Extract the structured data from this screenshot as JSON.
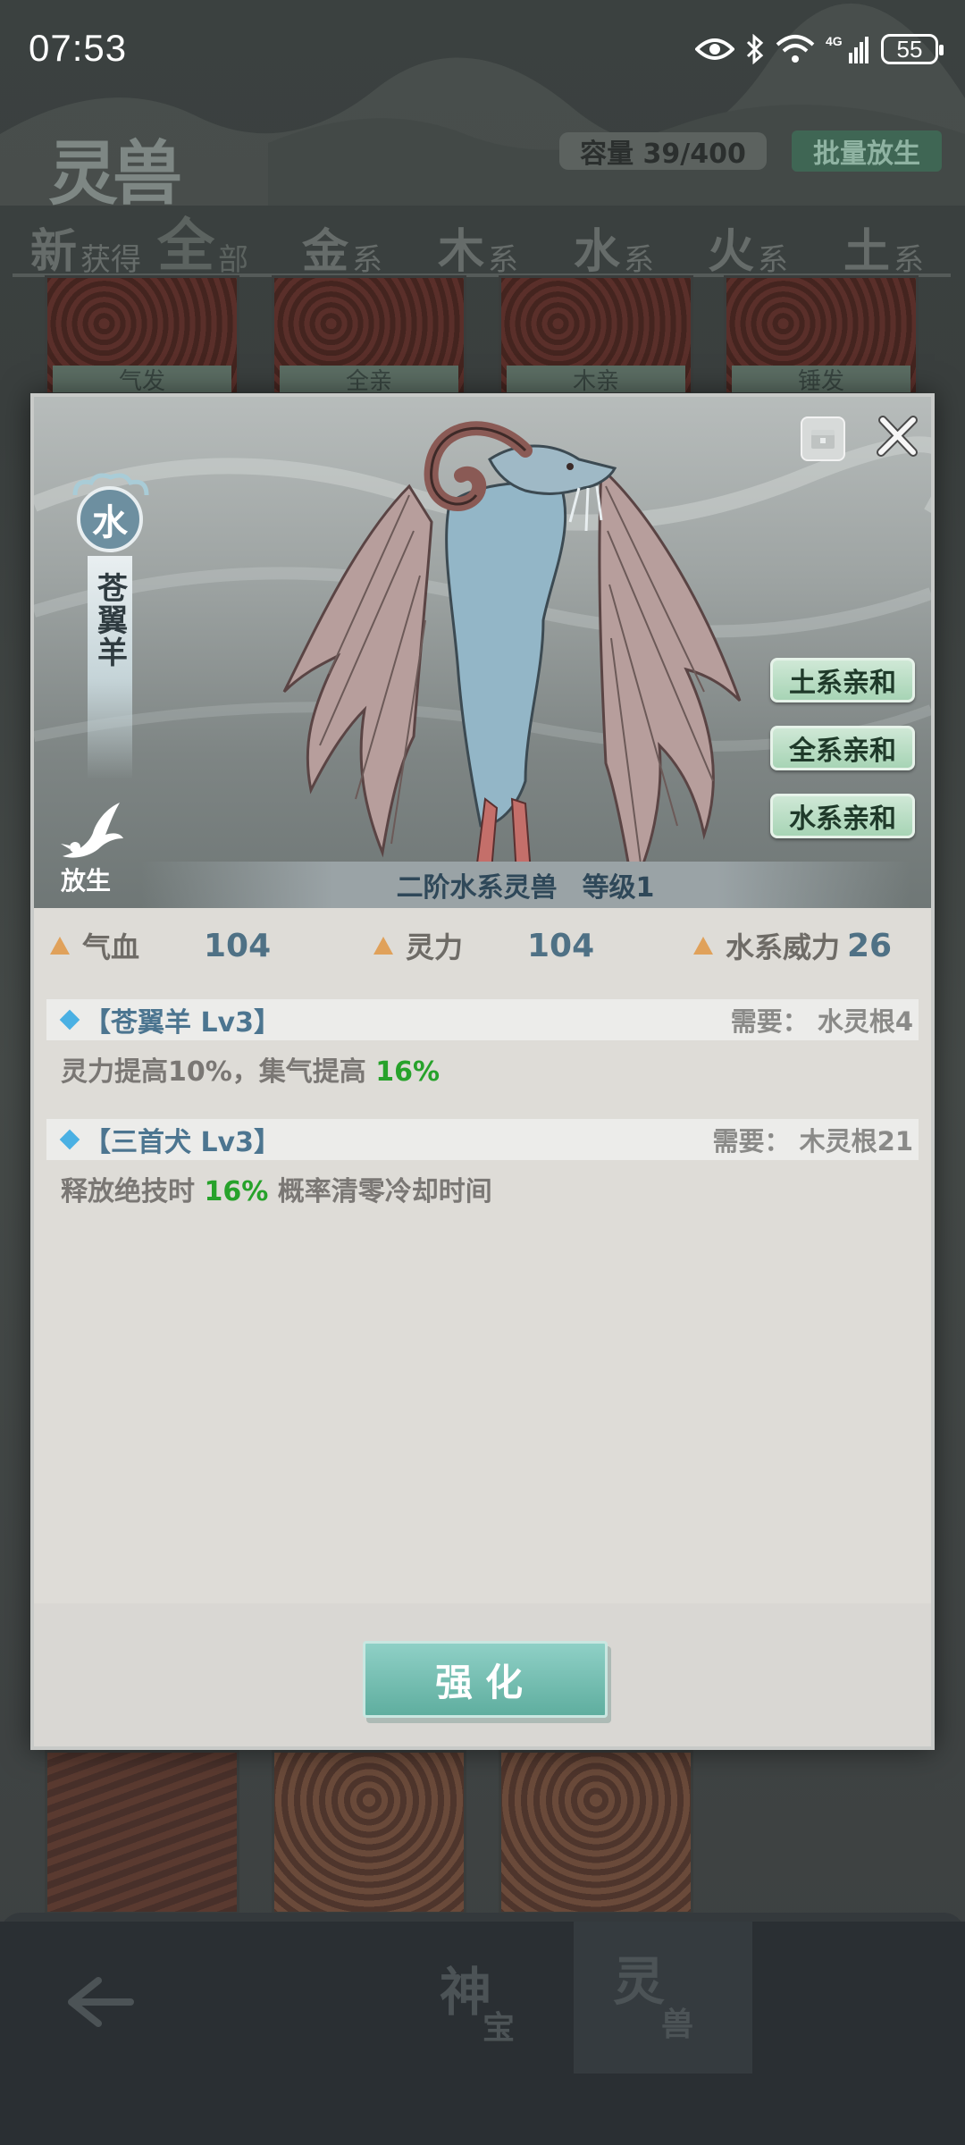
{
  "status_bar": {
    "time": "07:53",
    "network": "4G",
    "battery": "55",
    "icons": [
      "eye-icon",
      "bluetooth-icon",
      "wifi-icon",
      "signal-icon",
      "battery-icon"
    ]
  },
  "header": {
    "logo": "灵兽",
    "capacity": "容量 39/400",
    "batch_release": "批量放生"
  },
  "tabs": [
    {
      "big": "新",
      "small": "获得"
    },
    {
      "big": "全",
      "small": "部"
    },
    {
      "big": "金",
      "small": "系"
    },
    {
      "big": "木",
      "small": "系"
    },
    {
      "big": "水",
      "small": "系"
    },
    {
      "big": "火",
      "small": "系"
    },
    {
      "big": "土",
      "small": "系"
    }
  ],
  "background_cards": [
    "气发",
    "全亲",
    "木亲",
    "锤发"
  ],
  "modal": {
    "element": "水",
    "beast_name": "苍翼羊",
    "release_label": "放生",
    "affinities": [
      "土系亲和",
      "全系亲和",
      "水系亲和"
    ],
    "rank": "二阶水系灵兽",
    "level": "等级1",
    "stats": [
      {
        "label": "气血",
        "value": "104"
      },
      {
        "label": "灵力",
        "value": "104"
      },
      {
        "label": "水系威力",
        "value": "26"
      }
    ],
    "skills": [
      {
        "title": "【苍翼羊 Lv3】",
        "requirement": "需要：  水灵根4",
        "desc_before": "灵力提高10%，集气提高 ",
        "desc_highlight": "16%",
        "desc_after": ""
      },
      {
        "title": "【三首犬 Lv3】",
        "requirement": "需要：  木灵根21",
        "desc_before": "释放绝技时 ",
        "desc_highlight": "16%",
        "desc_after": " 概率清零冷却时间"
      }
    ],
    "upgrade_button": "强化",
    "colors": {
      "highlight": "#27a22b",
      "stat_value": "#4f7185",
      "affinity_bg": "#a7d4b5",
      "upgrade_bg": "#5fae9f"
    }
  },
  "bottom_nav": {
    "shenbao_big": "神",
    "shenbao_small": "宝",
    "lingshou_big": "灵",
    "lingshou_small": "兽"
  }
}
